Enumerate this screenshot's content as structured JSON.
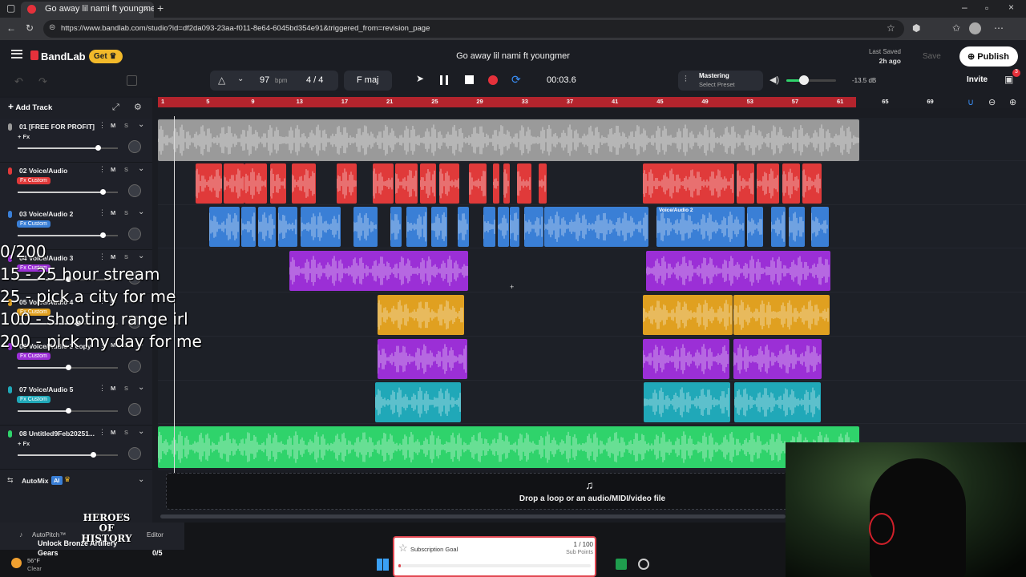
{
  "browser": {
    "tab_title": "Go away lil nami ft youngme",
    "url": "https://www.bandlab.com/studio?id=df2da093-23aa-f011-8e64-6045bd354e91&triggered_from=revision_page"
  },
  "app": {
    "brand": "BandLab",
    "get_label": "Get",
    "project_title": "Go away lil nami ft youngmer",
    "last_saved_label": "Last Saved",
    "last_saved_time": "2h ago",
    "save_label": "Save",
    "publish_label": "Publish",
    "invite_label": "Invite",
    "gift_count": "3",
    "accent_color": "#e5313b"
  },
  "transport": {
    "bpm_value": "97",
    "bpm_unit": "bpm",
    "time_signature": "4 / 4",
    "key": "F maj",
    "time": "00:03.6",
    "mastering_label": "Mastering",
    "mastering_preset": "Select Preset",
    "master_volume": "-13.5 dB"
  },
  "left_panel": {
    "add_track_label": "Add Track",
    "automix_label": "AutoMix",
    "ai_badge": "AI",
    "ms_m": "M",
    "ms_s": "S",
    "tracks": [
      {
        "name": "01 [FREE FOR PROFIT] ...",
        "fx": "+ Fx",
        "fx_type": "plain",
        "color": "#9a9a9a",
        "volume": 0.8
      },
      {
        "name": "02 Voice/Audio",
        "fx": "Fx Custom",
        "fx_type": "badge",
        "color": "#e03a3a",
        "volume": 0.85
      },
      {
        "name": "03 Voice/Audio 2",
        "fx": "Fx Custom",
        "fx_type": "badge",
        "color": "#3a7fd6",
        "volume": 0.85
      },
      {
        "name": "04 Voice/Audio 3",
        "fx": "Fx Custom",
        "fx_type": "badge",
        "color": "#9b2fd6",
        "volume": 0.5
      },
      {
        "name": "05 Voice/Audio 4",
        "fx": "Fx Custom",
        "fx_type": "badge",
        "color": "#e0a020",
        "volume": 0.6
      },
      {
        "name": "06 Voice/Audio 3 copy",
        "fx": "Fx Custom",
        "fx_type": "badge",
        "color": "#9b2fd6",
        "volume": 0.5
      },
      {
        "name": "07 Voice/Audio 5",
        "fx": "Fx Custom",
        "fx_type": "badge",
        "color": "#20a8b8",
        "volume": 0.5
      },
      {
        "name": "08 Untitled9Feb20251...",
        "fx": "+ Fx",
        "fx_type": "plain",
        "color": "#2fd36b",
        "volume": 0.75
      }
    ]
  },
  "timeline": {
    "bar_numbers": [
      "1",
      "5",
      "9",
      "13",
      "17",
      "21",
      "25",
      "29",
      "33",
      "37",
      "41",
      "45",
      "49",
      "53",
      "57",
      "61",
      "65",
      "69"
    ],
    "clip_label": "Voice/Audio 2",
    "drop_text": "Drop a loop or an audio/MIDI/video file"
  },
  "overlay": {
    "lines": [
      "0/200",
      "15 - 25 hour stream",
      "25 - pick a city for me",
      "100 - shooting range irl",
      "200 - pick my day for me"
    ]
  },
  "bottom": {
    "autopitch_label": "AutoPitch™",
    "editor_label": "Editor",
    "game_logo": "HEROES OF HISTORY",
    "unlock_text": "Unlock Bronze Artillery Gears",
    "unlock_progress": "0/5",
    "weather_temp": "56°F",
    "weather_desc": "Clear",
    "sub_goal_label": "Subscription Goal",
    "sub_goal_count": "1 / 100",
    "sub_goal_unit": "Sub Points",
    "sub_goal_progress": 0.01
  }
}
